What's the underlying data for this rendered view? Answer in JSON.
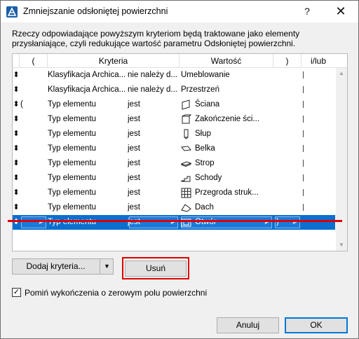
{
  "window": {
    "title": "Zmniejszanie odsłoniętej powierzchni",
    "help_label": "?",
    "close_label": "✕"
  },
  "description": "Rzeczy odpowiadające powyższym kryteriom będą traktowane jako elementy przysłaniające, czyli redukujące wartość parametru Odsłoniętej powierzchni.",
  "table": {
    "headers": {
      "open_paren": "(",
      "criteria": "Kryteria",
      "value": "Wartość",
      "close_paren": ")",
      "andor": "i/lub"
    },
    "rows": [
      {
        "drag": "⬍",
        "paren": "",
        "criteria": "Klasyfikacja Archica...",
        "operator": "nie należy d...",
        "value": "Umeblowanie",
        "icon": "none",
        "close": "",
        "andor": true
      },
      {
        "drag": "⬍",
        "paren": "",
        "criteria": "Klasyfikacja Archica...",
        "operator": "nie należy d...",
        "value": "Przestrzeń",
        "icon": "none",
        "close": "",
        "andor": true
      },
      {
        "drag": "⬍",
        "paren": "(",
        "criteria": "Typ elementu",
        "operator": "jest",
        "value": "Ściana",
        "icon": "wall-icon",
        "close": "",
        "andor": true
      },
      {
        "drag": "⬍",
        "paren": "",
        "criteria": "Typ elementu",
        "operator": "jest",
        "value": "Zakończenie ści...",
        "icon": "wall-end-icon",
        "close": "",
        "andor": true
      },
      {
        "drag": "⬍",
        "paren": "",
        "criteria": "Typ elementu",
        "operator": "jest",
        "value": "Słup",
        "icon": "column-icon",
        "close": "",
        "andor": true
      },
      {
        "drag": "⬍",
        "paren": "",
        "criteria": "Typ elementu",
        "operator": "jest",
        "value": "Belka",
        "icon": "beam-icon",
        "close": "",
        "andor": true
      },
      {
        "drag": "⬍",
        "paren": "",
        "criteria": "Typ elementu",
        "operator": "jest",
        "value": "Strop",
        "icon": "slab-icon",
        "close": "",
        "andor": true
      },
      {
        "drag": "⬍",
        "paren": "",
        "criteria": "Typ elementu",
        "operator": "jest",
        "value": "Schody",
        "icon": "stair-icon",
        "close": "",
        "andor": true
      },
      {
        "drag": "⬍",
        "paren": "",
        "criteria": "Typ elementu",
        "operator": "jest",
        "value": "Przegroda struk...",
        "icon": "curtain-wall-icon",
        "close": "",
        "andor": true
      },
      {
        "drag": "⬍",
        "paren": "",
        "criteria": "Typ elementu",
        "operator": "jest",
        "value": "Dach",
        "icon": "roof-icon",
        "close": "",
        "andor": true
      },
      {
        "drag": "⬍",
        "paren": "",
        "criteria": "Typ elementu",
        "operator": "jest",
        "value": "Otwór",
        "icon": "opening-icon",
        "close": ")",
        "andor": false,
        "selected": true
      }
    ]
  },
  "buttons": {
    "add_criteria": "Dodaj kryteria...",
    "add_arrow": "▼",
    "remove": "Usuń",
    "cancel": "Anuluj",
    "ok": "OK"
  },
  "checkbox": {
    "checked": true,
    "mark": "✓",
    "label": "Pomiń wykończenia o zerowym polu powierzchni"
  },
  "scroll": {
    "up": "▲",
    "down": "▼"
  },
  "colors": {
    "selection": "#0a6fcf",
    "highlight": "#e00000",
    "ok_border": "#0078d7"
  }
}
